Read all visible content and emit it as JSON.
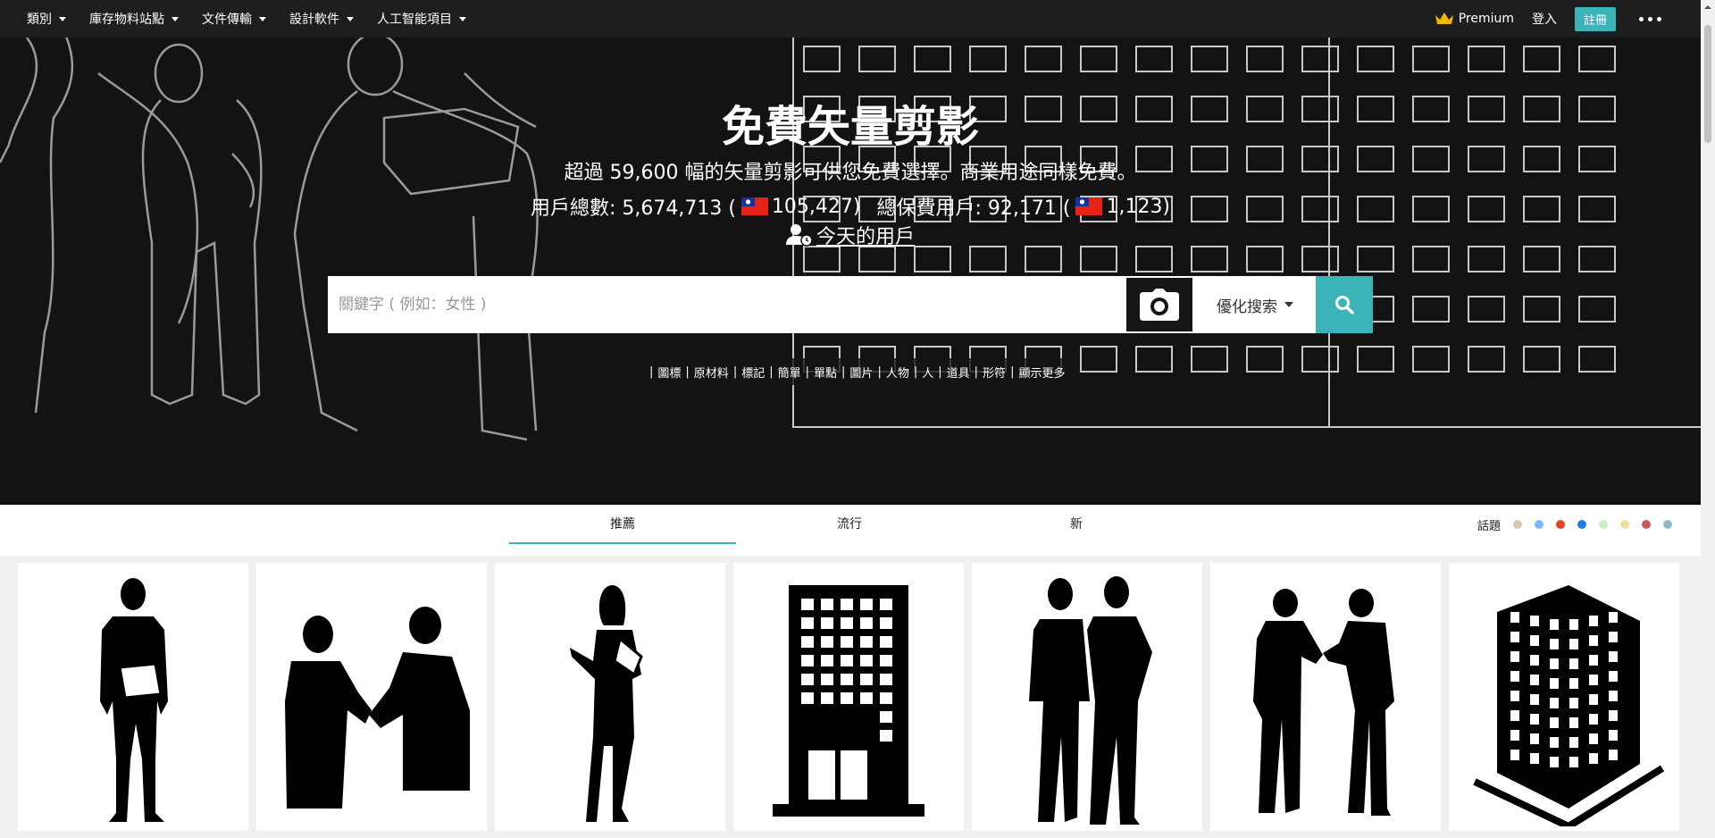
{
  "nav": {
    "items": [
      {
        "label": "類別"
      },
      {
        "label": "庫存物料站點"
      },
      {
        "label": "文件傳輸"
      },
      {
        "label": "設計軟件"
      },
      {
        "label": "人工智能項目"
      }
    ],
    "premium_label": "Premium",
    "login_label": "登入",
    "signup_label": "註冊",
    "more_icon": "more-dots-icon",
    "accent_color": "#3ab3b9"
  },
  "hero": {
    "title": "免費矢量剪影",
    "subtitle": "超過 59,600 幅的矢量剪影可供您免費選擇。商業用途同樣免費。",
    "stats": {
      "users_label": "用戶總數: 5,674,713 (",
      "users_tw": "105,427)",
      "premium_label": "總保費用戶: 92,171 (",
      "premium_tw": "1,123)"
    },
    "today_users": "今天的用戶"
  },
  "search": {
    "placeholder": "關鍵字 ( 例如：女性 )",
    "value": "",
    "refine_label": "優化搜索",
    "camera_icon": "camera-icon",
    "search_icon": "search-icon"
  },
  "tags": [
    "圖標",
    "原材料",
    "標記",
    "簡單",
    "單點",
    "圖片",
    "人物",
    "人",
    "道具",
    "形符",
    "顯示更多"
  ],
  "tabs": [
    {
      "label": "推薦",
      "active": true
    },
    {
      "label": "流行",
      "active": false
    },
    {
      "label": "新",
      "active": false
    }
  ],
  "topics": {
    "label": "話題",
    "colors": [
      "#d8c8b0",
      "#7ab8f0",
      "#e8412a",
      "#1f7ee8",
      "#c8f0c0",
      "#f0e0a0",
      "#c85a5a",
      "#8fb8c8"
    ]
  },
  "grid_items": [
    {
      "name": "businessman-with-folder"
    },
    {
      "name": "handshake"
    },
    {
      "name": "businesswoman-with-documents"
    },
    {
      "name": "office-building"
    },
    {
      "name": "two-businessmen"
    },
    {
      "name": "business-bowing-greeting"
    },
    {
      "name": "building-3d"
    }
  ]
}
